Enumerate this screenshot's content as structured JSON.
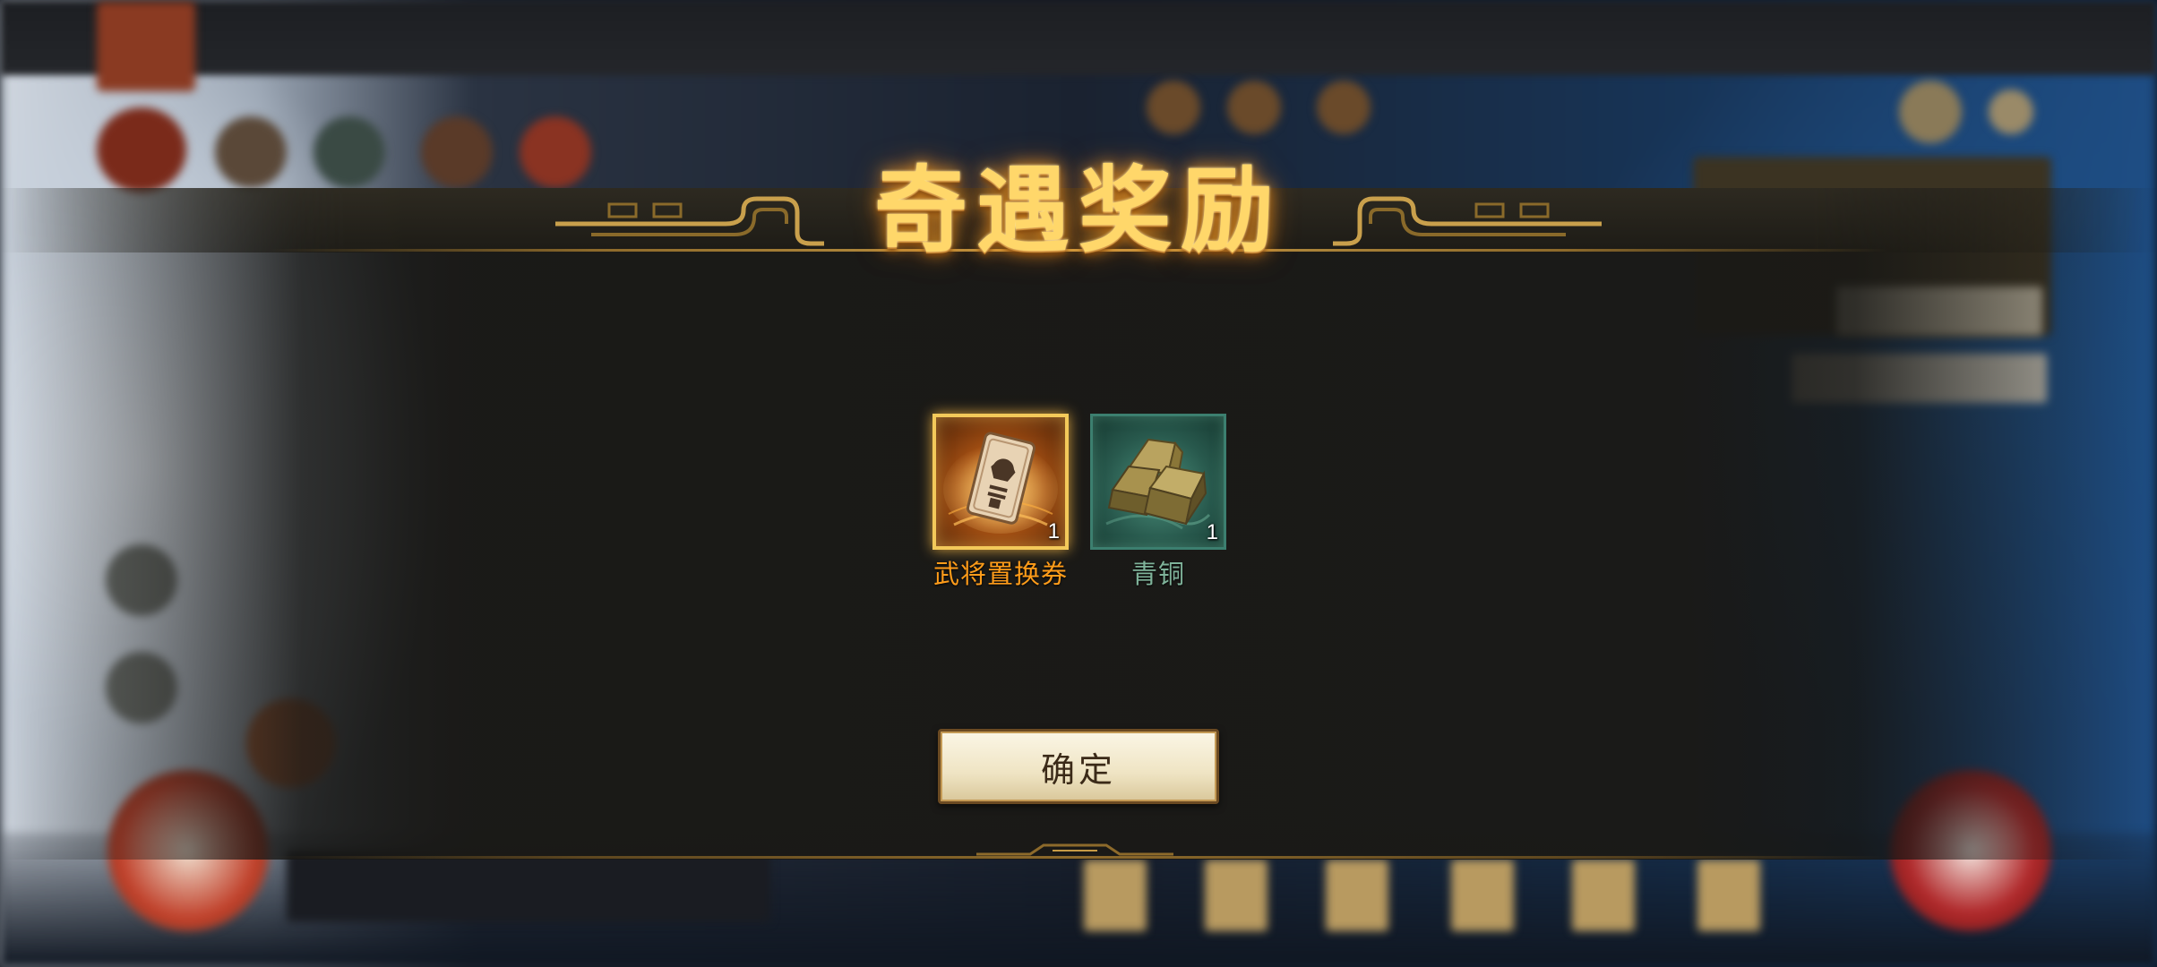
{
  "dialog": {
    "title": "奇遇奖励",
    "rewards": [
      {
        "name": "武将置换券",
        "count": "1",
        "icon": "swap-voucher-card-icon",
        "quality": "gold"
      },
      {
        "name": "青铜",
        "count": "1",
        "icon": "bronze-ingots-icon",
        "quality": "green"
      }
    ],
    "confirm_label": "确定"
  },
  "colors": {
    "title_gold": "#ffd76a",
    "reward_orange": "#ff9c1a",
    "reward_teal": "#7fb39a",
    "button_face": "#f3ead0"
  }
}
